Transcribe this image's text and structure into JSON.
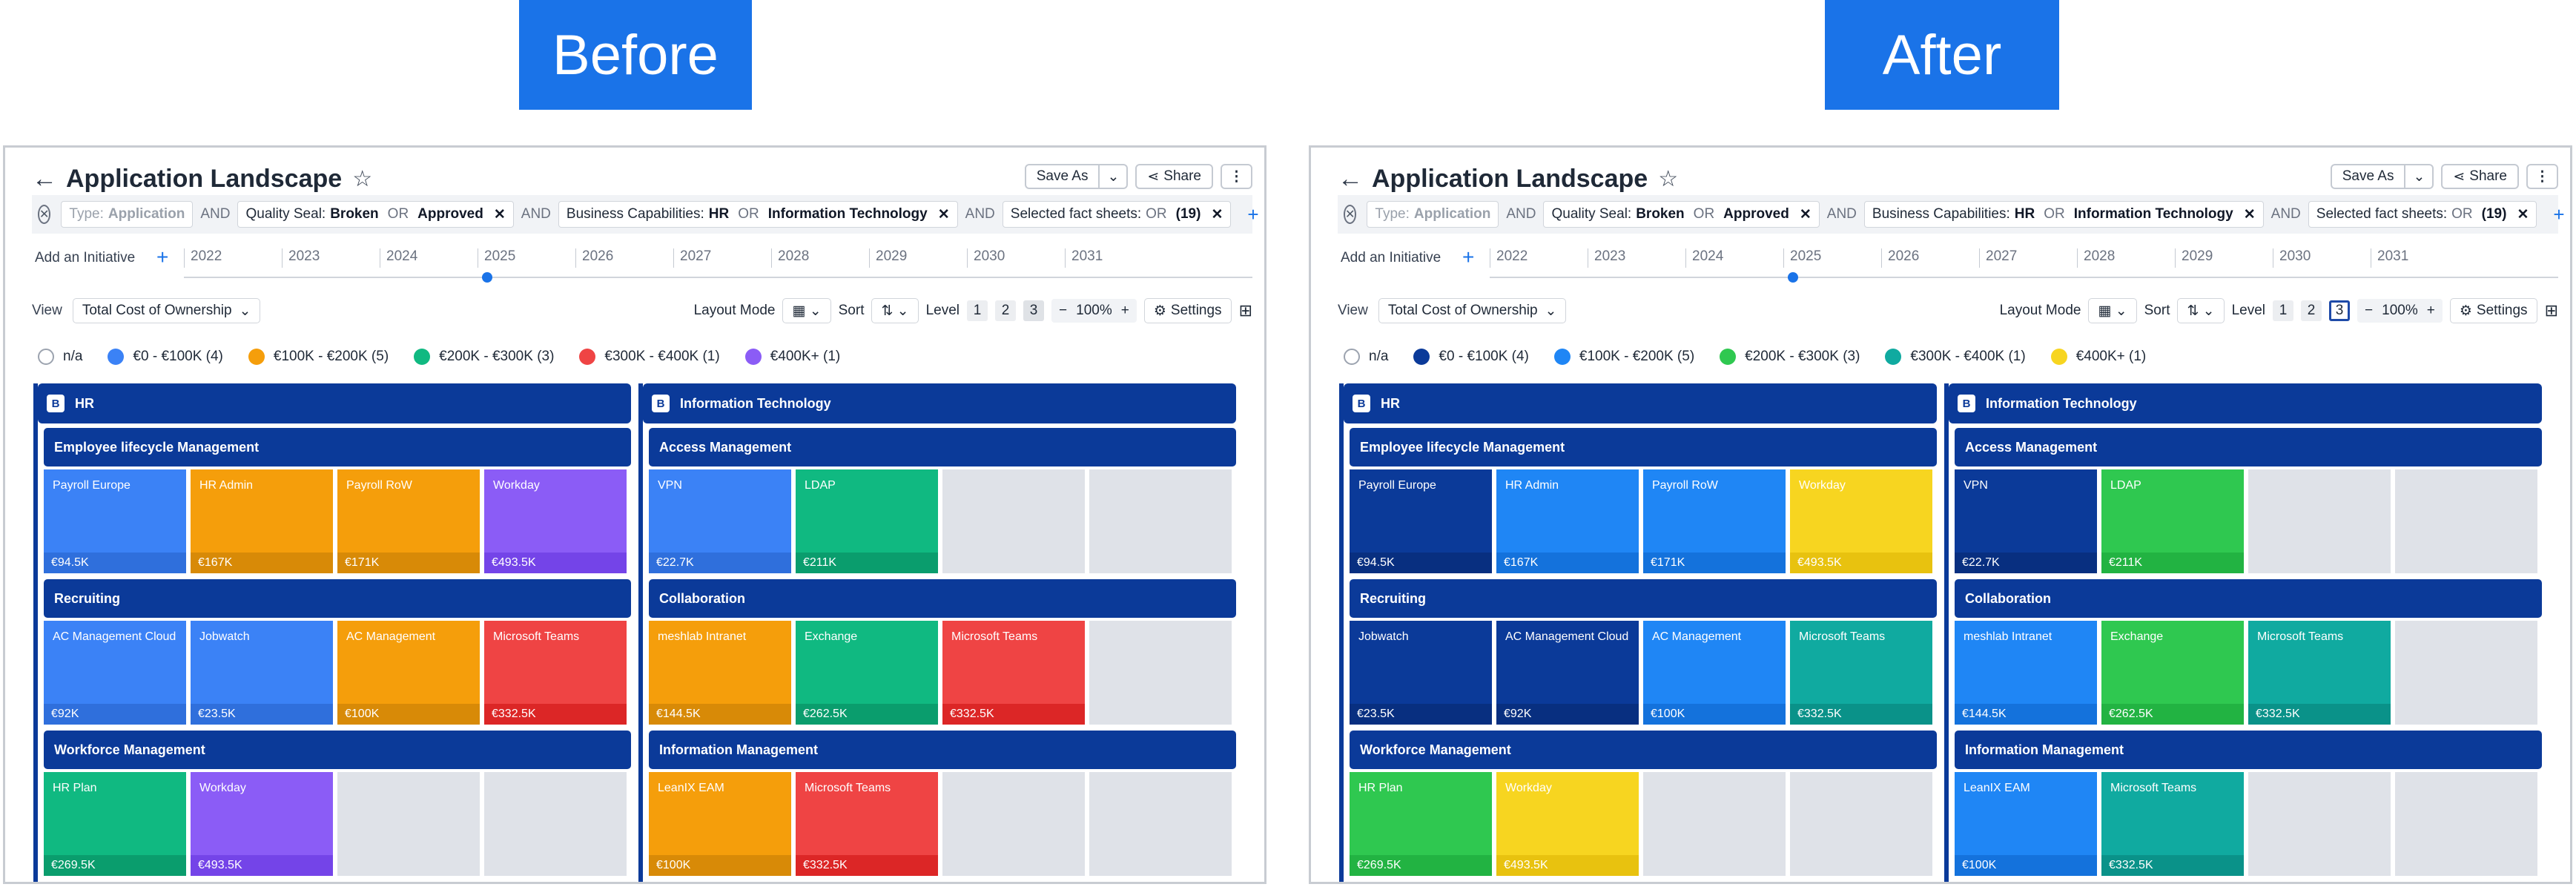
{
  "banners": {
    "before": "Before",
    "after": "After"
  },
  "app": {
    "title": "Application Landscape",
    "save_as": "Save As",
    "share": "Share",
    "more": "⋮",
    "filters": {
      "type_label": "Type:",
      "type_value": "Application",
      "and": "AND",
      "or": "OR",
      "quality_label": "Quality Seal:",
      "quality_v1": "Broken",
      "quality_v2": "Approved",
      "bc_label": "Business Capabilities:",
      "bc_v1": "HR",
      "bc_v2": "Information Technology",
      "sel_label": "Selected fact sheets:",
      "sel_value": "(19)"
    },
    "add_initiative": "Add an Initiative",
    "years": [
      "2022",
      "2023",
      "2024",
      "2025",
      "2026",
      "2027",
      "2028",
      "2029",
      "2030",
      "2031"
    ],
    "view_label": "View",
    "view_value": "Total Cost of Ownership",
    "layout_mode": "Layout Mode",
    "sort": "Sort",
    "level": "Level",
    "levels": [
      "1",
      "2",
      "3"
    ],
    "zoom": "100%",
    "settings": "Settings",
    "legend_labels": [
      "n/a",
      "€0 - €100K (4)",
      "€100K - €200K (5)",
      "€200K - €300K (3)",
      "€300K - €400K (1)",
      "€400K+ (1)"
    ],
    "group_badge": "B",
    "groups": [
      "HR",
      "Information Technology"
    ]
  },
  "before": {
    "legend_colors": [
      "#ffffff",
      "#3b82f6",
      "#f59e0b",
      "#10b981",
      "#ef4444",
      "#8b5cf6"
    ],
    "hr": [
      {
        "name": "Employee lifecycle Management",
        "tiles": [
          {
            "name": "Payroll Europe",
            "cost": "€94.5K",
            "color": "#3b82f6",
            "foot": "#2f6fdc"
          },
          {
            "name": "HR Admin",
            "cost": "€167K",
            "color": "#f59e0b",
            "foot": "#d88a07"
          },
          {
            "name": "Payroll RoW",
            "cost": "€171K",
            "color": "#f59e0b",
            "foot": "#d88a07"
          },
          {
            "name": "Workday",
            "cost": "€493.5K",
            "color": "#8b5cf6",
            "foot": "#7444e8"
          }
        ]
      },
      {
        "name": "Recruiting",
        "tiles": [
          {
            "name": "AC Management Cloud",
            "cost": "€92K",
            "color": "#3b82f6",
            "foot": "#2f6fdc"
          },
          {
            "name": "Jobwatch",
            "cost": "€23.5K",
            "color": "#3b82f6",
            "foot": "#2f6fdc"
          },
          {
            "name": "AC Management",
            "cost": "€100K",
            "color": "#f59e0b",
            "foot": "#d88a07"
          },
          {
            "name": "Microsoft Teams",
            "cost": "€332.5K",
            "color": "#ef4444",
            "foot": "#dc2626"
          }
        ]
      },
      {
        "name": "Workforce Management",
        "tiles": [
          {
            "name": "HR Plan",
            "cost": "€269.5K",
            "color": "#10b981",
            "foot": "#0a9d6d"
          },
          {
            "name": "Workday",
            "cost": "€493.5K",
            "color": "#8b5cf6",
            "foot": "#7444e8"
          }
        ]
      }
    ],
    "it": [
      {
        "name": "Access Management",
        "tiles": [
          {
            "name": "VPN",
            "cost": "€22.7K",
            "color": "#3b82f6",
            "foot": "#2f6fdc"
          },
          {
            "name": "LDAP",
            "cost": "€211K",
            "color": "#10b981",
            "foot": "#0a9d6d"
          }
        ]
      },
      {
        "name": "Collaboration",
        "tiles": [
          {
            "name": "meshlab Intranet",
            "cost": "€144.5K",
            "color": "#f59e0b",
            "foot": "#d88a07"
          },
          {
            "name": "Exchange",
            "cost": "€262.5K",
            "color": "#10b981",
            "foot": "#0a9d6d"
          },
          {
            "name": "Microsoft Teams",
            "cost": "€332.5K",
            "color": "#ef4444",
            "foot": "#dc2626"
          }
        ]
      },
      {
        "name": "Information Management",
        "tiles": [
          {
            "name": "LeanIX EAM",
            "cost": "€100K",
            "color": "#f59e0b",
            "foot": "#d88a07"
          },
          {
            "name": "Microsoft Teams",
            "cost": "€332.5K",
            "color": "#ef4444",
            "foot": "#dc2626"
          }
        ]
      }
    ]
  },
  "after": {
    "legend_colors": [
      "#ffffff",
      "#0b3a99",
      "#1f86f5",
      "#2fc850",
      "#10aaa0",
      "#f7d520"
    ],
    "hr": [
      {
        "name": "Employee lifecycle Management",
        "tiles": [
          {
            "name": "Payroll Europe",
            "cost": "€94.5K",
            "color": "#0b3a99",
            "foot": "#082f80"
          },
          {
            "name": "HR Admin",
            "cost": "€167K",
            "color": "#1f86f5",
            "foot": "#1472dc"
          },
          {
            "name": "Payroll RoW",
            "cost": "€171K",
            "color": "#1f86f5",
            "foot": "#1472dc"
          },
          {
            "name": "Workday",
            "cost": "€493.5K",
            "color": "#f7d520",
            "foot": "#e8c20f"
          }
        ]
      },
      {
        "name": "Recruiting",
        "tiles": [
          {
            "name": "Jobwatch",
            "cost": "€23.5K",
            "color": "#0b3a99",
            "foot": "#082f80"
          },
          {
            "name": "AC Management Cloud",
            "cost": "€92K",
            "color": "#0b3a99",
            "foot": "#082f80"
          },
          {
            "name": "AC Management",
            "cost": "€100K",
            "color": "#1f86f5",
            "foot": "#1472dc"
          },
          {
            "name": "Microsoft Teams",
            "cost": "€332.5K",
            "color": "#10aaa0",
            "foot": "#0a9289"
          }
        ]
      },
      {
        "name": "Workforce Management",
        "tiles": [
          {
            "name": "HR Plan",
            "cost": "€269.5K",
            "color": "#2fc850",
            "foot": "#22b342"
          },
          {
            "name": "Workday",
            "cost": "€493.5K",
            "color": "#f7d520",
            "foot": "#e8c20f"
          }
        ]
      }
    ],
    "it": [
      {
        "name": "Access Management",
        "tiles": [
          {
            "name": "VPN",
            "cost": "€22.7K",
            "color": "#0b3a99",
            "foot": "#082f80"
          },
          {
            "name": "LDAP",
            "cost": "€211K",
            "color": "#2fc850",
            "foot": "#22b342"
          }
        ]
      },
      {
        "name": "Collaboration",
        "tiles": [
          {
            "name": "meshlab Intranet",
            "cost": "€144.5K",
            "color": "#1f86f5",
            "foot": "#1472dc"
          },
          {
            "name": "Exchange",
            "cost": "€262.5K",
            "color": "#2fc850",
            "foot": "#22b342"
          },
          {
            "name": "Microsoft Teams",
            "cost": "€332.5K",
            "color": "#10aaa0",
            "foot": "#0a9289"
          }
        ]
      },
      {
        "name": "Information Management",
        "tiles": [
          {
            "name": "LeanIX EAM",
            "cost": "€100K",
            "color": "#1f86f5",
            "foot": "#1472dc"
          },
          {
            "name": "Microsoft Teams",
            "cost": "€332.5K",
            "color": "#10aaa0",
            "foot": "#0a9289"
          }
        ]
      }
    ]
  }
}
